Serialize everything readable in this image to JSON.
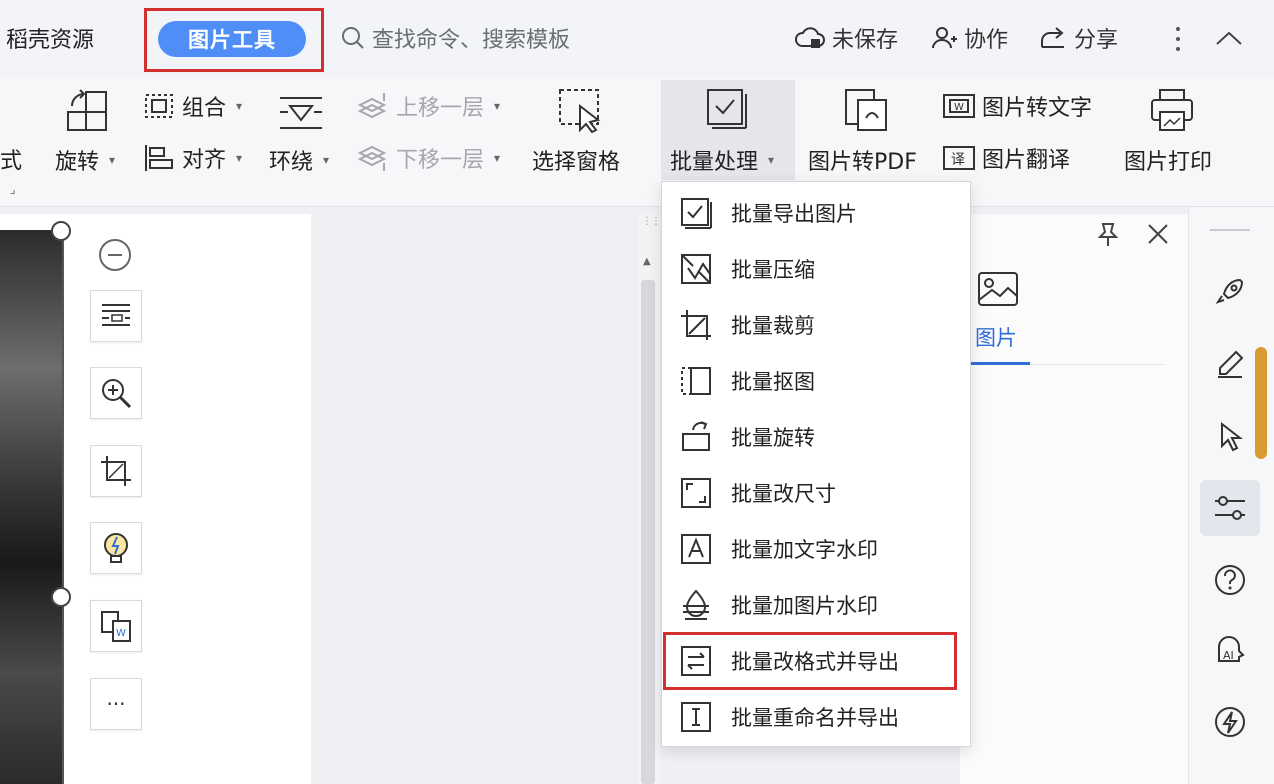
{
  "topbar": {
    "left_tab": "稻壳资源",
    "active_tab": "图片工具",
    "search_placeholder": "查找命令、搜索模板",
    "unsaved": "未保存",
    "collaborate": "协作",
    "share": "分享"
  },
  "ribbon": {
    "partial_label": "式",
    "rotate": "旋转",
    "group": "组合",
    "align": "对齐",
    "wrap": "环绕",
    "bring_forward": "上移一层",
    "send_backward": "下移一层",
    "selection_pane": "选择窗格",
    "batch": "批量处理",
    "to_pdf": "图片转PDF",
    "to_text": "图片转文字",
    "translate": "图片翻译",
    "print": "图片打印"
  },
  "batch_menu": {
    "items": [
      {
        "label": "批量导出图片",
        "icon": "export-check-icon"
      },
      {
        "label": "批量压缩",
        "icon": "compress-icon"
      },
      {
        "label": "批量裁剪",
        "icon": "crop-icon"
      },
      {
        "label": "批量抠图",
        "icon": "cutout-icon"
      },
      {
        "label": "批量旋转",
        "icon": "rotate-icon"
      },
      {
        "label": "批量改尺寸",
        "icon": "resize-icon"
      },
      {
        "label": "批量加文字水印",
        "icon": "text-watermark-icon"
      },
      {
        "label": "批量加图片水印",
        "icon": "image-watermark-icon"
      },
      {
        "label": "批量改格式并导出",
        "icon": "convert-format-icon"
      },
      {
        "label": "批量重命名并导出",
        "icon": "rename-icon"
      }
    ],
    "highlighted_index": 8
  },
  "panel": {
    "tab_label": "图片"
  },
  "float_toolbar": {
    "more": "···"
  },
  "colors": {
    "accent": "#4f8ef7",
    "highlight_border": "#d42f2f",
    "panel_accent": "#2f6fd6"
  }
}
